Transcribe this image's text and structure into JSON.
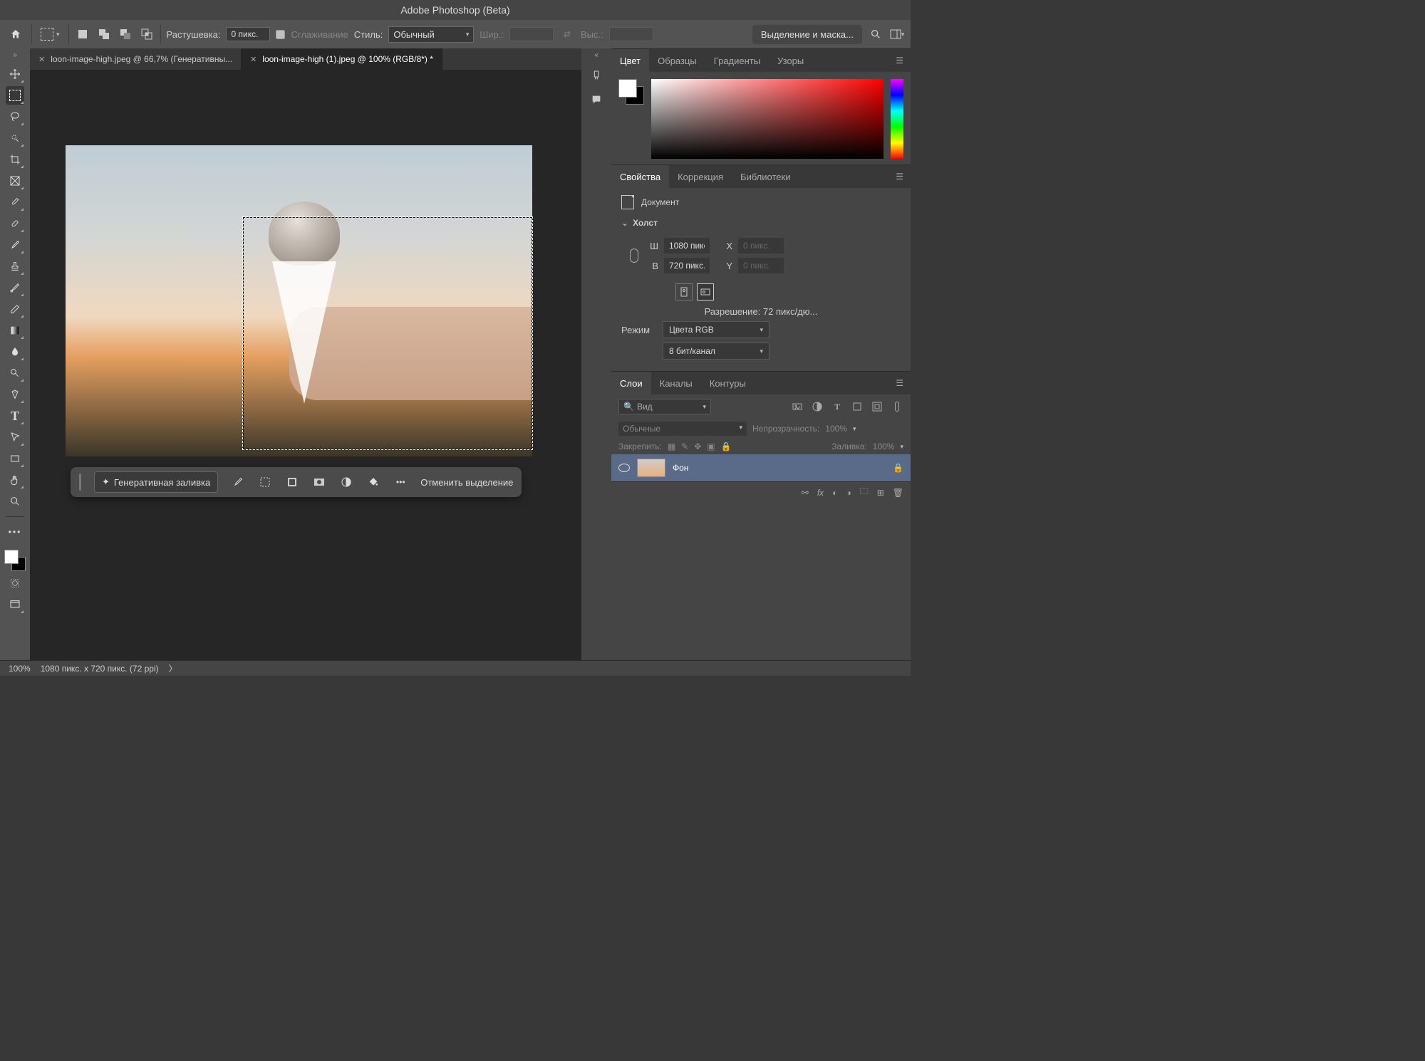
{
  "app": {
    "title": "Adobe Photoshop (Beta)"
  },
  "options": {
    "feather_label": "Растушевка:",
    "feather_value": "0 пикс.",
    "antialias": "Сглаживание",
    "style_label": "Стиль:",
    "style_value": "Обычный",
    "width_label": "Шир.:",
    "height_label": "Выс.:",
    "select_mask": "Выделение и маска..."
  },
  "tabs": [
    {
      "label": "loon-image-high.jpeg @ 66,7% (Генеративны...",
      "active": false
    },
    {
      "label": "loon-image-high (1).jpeg @ 100% (RGB/8*) *",
      "active": true
    }
  ],
  "context": {
    "gen_fill": "Генеративная заливка",
    "deselect": "Отменить выделение"
  },
  "panels": {
    "color": {
      "tabs": [
        "Цвет",
        "Образцы",
        "Градиенты",
        "Узоры"
      ],
      "active": 0
    },
    "props": {
      "tabs": [
        "Свойства",
        "Коррекция",
        "Библиотеки"
      ],
      "active": 0,
      "doc_label": "Документ",
      "canvas_label": "Холст",
      "w_label": "Ш",
      "w_value": "1080 пикс",
      "h_label": "В",
      "h_value": "720 пикс.",
      "x_label": "X",
      "x_value": "0 пикс.",
      "y_label": "Y",
      "y_value": "0 пикс.",
      "resolution": "Разрешение: 72 пикс/дю...",
      "mode_label": "Режим",
      "mode_value": "Цвета RGB",
      "bits_value": "8 бит/канал"
    },
    "layers": {
      "tabs": [
        "Слои",
        "Каналы",
        "Контуры"
      ],
      "active": 0,
      "search": "Вид",
      "blend": "Обычные",
      "opacity_label": "Непрозрачность:",
      "opacity_value": "100%",
      "lock_label": "Закрепить:",
      "fill_label": "Заливка:",
      "fill_value": "100%",
      "layer_name": "Фон"
    }
  },
  "status": {
    "zoom": "100%",
    "dims": "1080 пикс. x 720 пикс. (72 ppi)"
  }
}
